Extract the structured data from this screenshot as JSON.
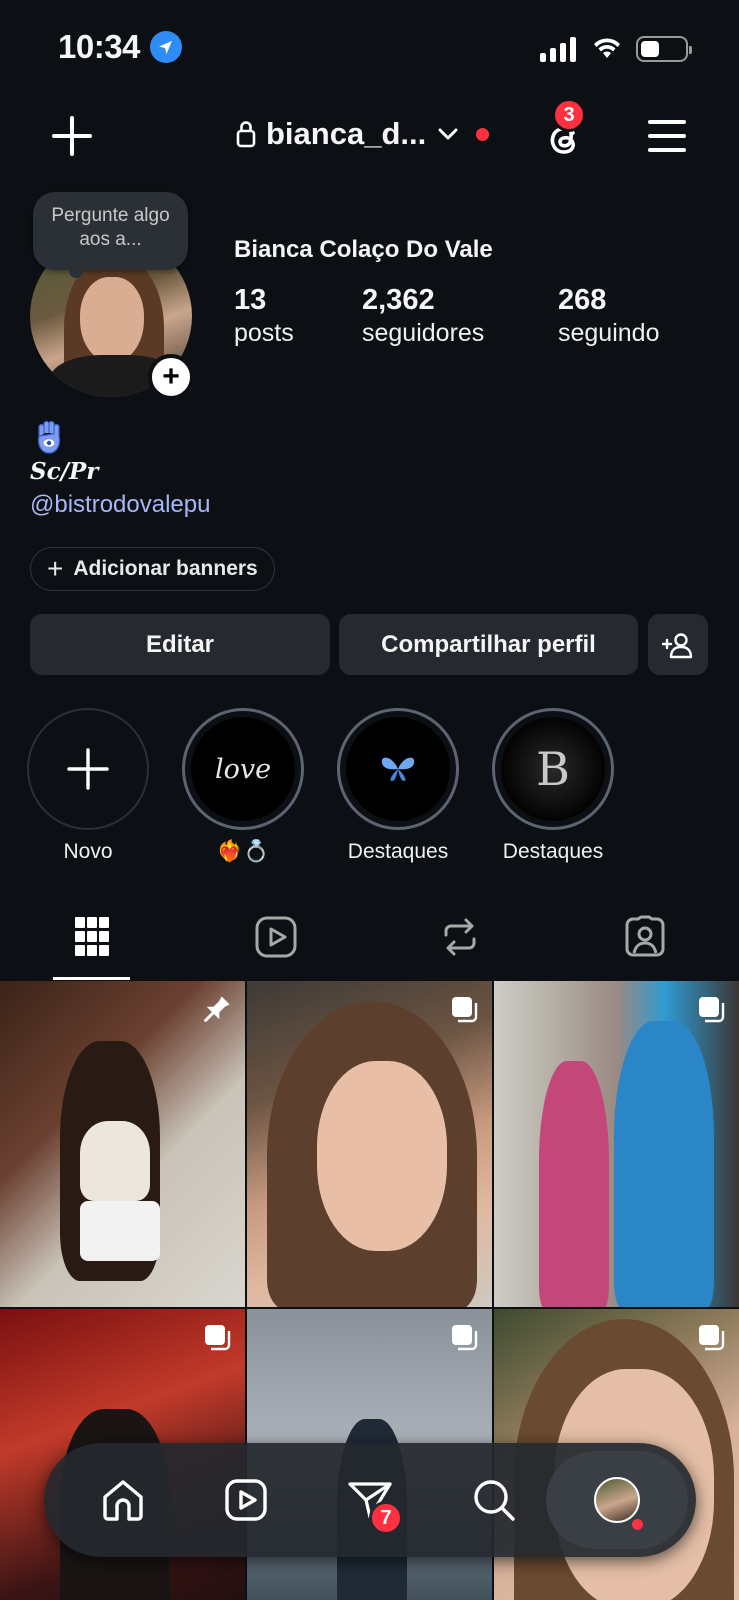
{
  "status_bar": {
    "time": "10:34"
  },
  "header": {
    "username": "bianca_d...",
    "threads_badge": "3"
  },
  "note": {
    "text": "Pergunte algo aos a..."
  },
  "profile": {
    "full_name": "Bianca Colaço Do Vale",
    "stats": [
      {
        "value": "13",
        "label": "posts"
      },
      {
        "value": "2,362",
        "label": "seguidores"
      },
      {
        "value": "268",
        "label": "seguindo"
      }
    ],
    "bio_emoji": "hamsa-icon",
    "bio_text": "Sc/Pr",
    "bio_link": "@bistrodovalepu",
    "banner_button": "Adicionar banners"
  },
  "actions": {
    "edit": "Editar",
    "share": "Compartilhar perfil"
  },
  "highlights": [
    {
      "label": "Novo",
      "type": "new"
    },
    {
      "label": "❤️‍🔥💍",
      "cover_text": "love"
    },
    {
      "label": "Destaques",
      "cover": "butterfly"
    },
    {
      "label": "Destaques",
      "cover_text": "B"
    }
  ],
  "tabs": [
    "grid-icon",
    "reels-icon",
    "reposts-icon",
    "tagged-icon"
  ],
  "bottom_nav": {
    "messages_badge": "7",
    "items": [
      "home-icon",
      "reels-icon",
      "messages-icon",
      "search-icon",
      "profile-avatar"
    ]
  },
  "colors": {
    "background": "#0c1014",
    "button": "#262a30",
    "link": "#a7b7f5",
    "notification": "#ff3040"
  }
}
